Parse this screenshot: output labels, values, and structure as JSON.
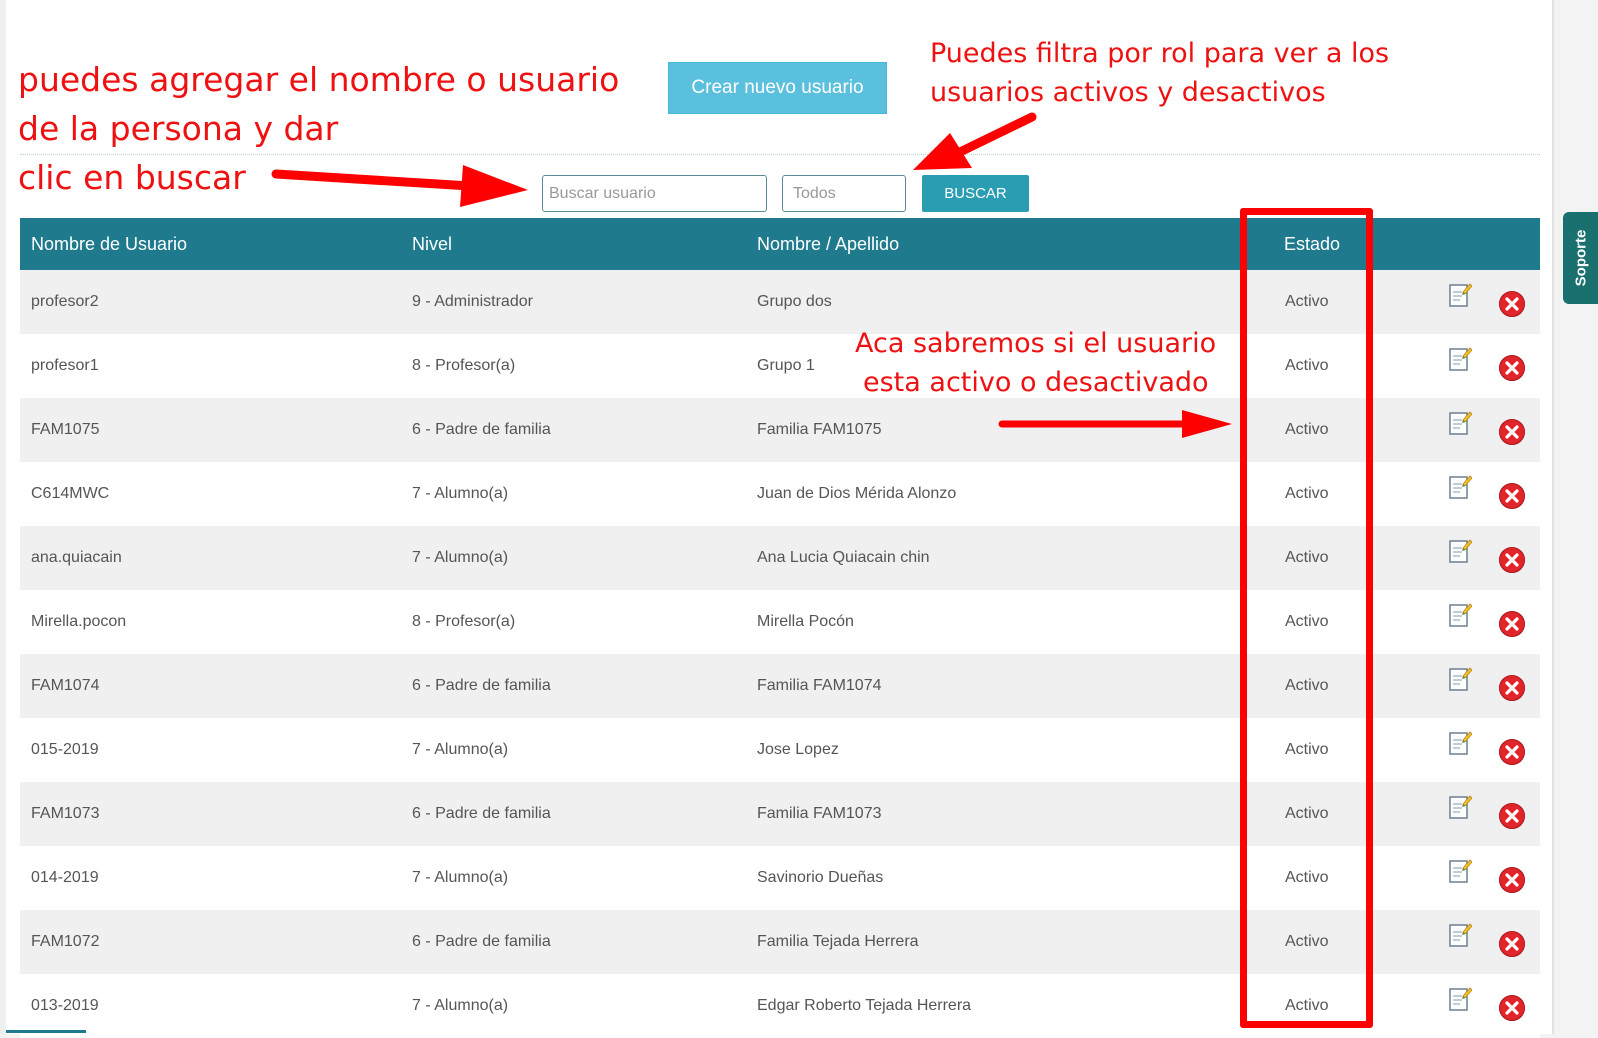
{
  "toolbar": {
    "create_label": "Crear nuevo usuario",
    "search_placeholder": "Buscar usuario",
    "role_filter_value": "Todos",
    "search_label": "BUSCAR"
  },
  "table": {
    "headers": [
      "Nombre de Usuario",
      "Nivel",
      "Nombre / Apellido",
      "Estado"
    ],
    "rows": [
      {
        "usuario": "profesor2",
        "nivel": "9 - Administrador",
        "nombre": "Grupo dos",
        "estado": "Activo"
      },
      {
        "usuario": "profesor1",
        "nivel": "8 - Profesor(a)",
        "nombre": "Grupo 1",
        "estado": "Activo"
      },
      {
        "usuario": "FAM1075",
        "nivel": "6 - Padre de familia",
        "nombre": "Familia FAM1075",
        "estado": "Activo"
      },
      {
        "usuario": "C614MWC",
        "nivel": "7 - Alumno(a)",
        "nombre": "Juan de Dios Mérida Alonzo",
        "estado": "Activo"
      },
      {
        "usuario": "ana.quiacain",
        "nivel": "7 - Alumno(a)",
        "nombre": "Ana Lucia Quiacain chin",
        "estado": "Activo"
      },
      {
        "usuario": "Mirella.pocon",
        "nivel": "8 - Profesor(a)",
        "nombre": "Mirella Pocón",
        "estado": "Activo"
      },
      {
        "usuario": "FAM1074",
        "nivel": "6 - Padre de familia",
        "nombre": "Familia FAM1074",
        "estado": "Activo"
      },
      {
        "usuario": "015-2019",
        "nivel": "7 - Alumno(a)",
        "nombre": "Jose Lopez",
        "estado": "Activo"
      },
      {
        "usuario": "FAM1073",
        "nivel": "6 - Padre de familia",
        "nombre": "Familia FAM1073",
        "estado": "Activo"
      },
      {
        "usuario": "014-2019",
        "nivel": "7 - Alumno(a)",
        "nombre": "Savinorio Dueñas",
        "estado": "Activo"
      },
      {
        "usuario": "FAM1072",
        "nivel": "6 - Padre de familia",
        "nombre": "Familia Tejada Herrera",
        "estado": "Activo"
      },
      {
        "usuario": "013-2019",
        "nivel": "7 - Alumno(a)",
        "nombre": "Edgar Roberto Tejada Herrera",
        "estado": "Activo"
      }
    ],
    "row_icons": [
      "edit-icon",
      "delete-icon"
    ]
  },
  "support_tab": {
    "label": "Soporte"
  },
  "annotations": {
    "search_hint": [
      "puedes agregar el nombre o usuario",
      "de la persona y dar",
      "clic en buscar"
    ],
    "filter_hint": [
      "Puedes filtra por rol para ver a los",
      "usuarios activos y desactivos"
    ],
    "status_hint": [
      "Aca sabremos si el usuario",
      "esta activo o desactivado"
    ]
  },
  "colors": {
    "header_bg": "#1e7a8c",
    "create_button": "#5bc0de",
    "search_button": "#2a9db3",
    "annotation_red": "#ff0000",
    "support_tab": "#1a6f6f"
  }
}
